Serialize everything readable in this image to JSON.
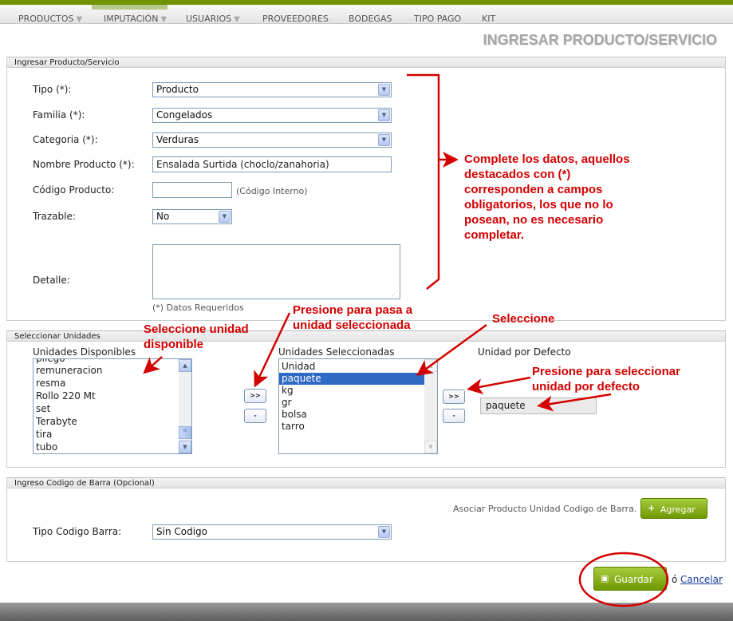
{
  "nav": {
    "items": [
      {
        "label": "PRODUCTOS",
        "arrow": "▼"
      },
      {
        "label": "IMPUTACIÓN",
        "arrow": "▼"
      },
      {
        "label": "USUARIOS",
        "arrow": "▼"
      },
      {
        "label": "PROVEEDORES"
      },
      {
        "label": "BODEGAS"
      },
      {
        "label": "TIPO PAGO"
      },
      {
        "label": "KIT"
      }
    ]
  },
  "page_title": "INGRESAR PRODUCTO/SERVICIO",
  "product_section": {
    "legend": "Ingresar Producto/Servicio",
    "tipo": {
      "label": "Tipo (*):",
      "value": "Producto"
    },
    "familia": {
      "label": "Familia (*):",
      "value": "Congelados"
    },
    "categoria": {
      "label": "Categoria (*):",
      "value": "Verduras"
    },
    "nombre": {
      "label": "Nombre Producto (*):",
      "value": "Ensalada Surtida (choclo/zanahoria)"
    },
    "codigo": {
      "label": "Código Producto:",
      "value": "",
      "hint": "(Código Interno)"
    },
    "trazable": {
      "label": "Trazable:",
      "value": "No"
    },
    "detalle": {
      "label": "Detalle:",
      "value": ""
    },
    "required_note": "(*) Datos Requeridos"
  },
  "units_section": {
    "legend": "Seleccionar Unidades",
    "available_label": "Unidades Disponibles",
    "available_items": [
      "pliego",
      "remuneracion",
      "resma",
      "Rollo 220 Mt",
      "set",
      "Terabyte",
      "tira",
      "tubo"
    ],
    "selected_label": "Unidades Seleccionadas",
    "selected_items": [
      "Unidad",
      "paquete",
      "kg",
      "gr",
      "bolsa",
      "tarro"
    ],
    "selected_highlight": "paquete",
    "default_label": "Unidad por Defecto",
    "default_value": "paquete",
    "add_button": ">>",
    "remove_button": "-",
    "set_default_button": ">>",
    "clear_default_button": "-"
  },
  "barcode_section": {
    "legend": "Ingreso Codigo de Barra (Opcional)",
    "associate_text": "Asociar Producto Unidad Codigo de Barra.",
    "add_button": "Agregar",
    "add_icon": "+",
    "tipo_label": "Tipo Codigo Barra:",
    "tipo_value": "Sin Codigo"
  },
  "actions": {
    "save_label": "Guardar",
    "save_icon": "▣",
    "separator": "ó",
    "cancel_label": "Cancelar"
  },
  "annotations": {
    "complete": "Complete los datos, aquellos destacados con (*) corresponden a campos obligatorios, los que no lo posean, no es necesario completar.",
    "presione_pasa": "Presione para pasa a unidad seleccionada",
    "seleccione_unidad": "Seleccione unidad disponible",
    "seleccione": "Seleccione",
    "presione_defecto": "Presione para seleccionar unidad por defecto"
  },
  "colors": {
    "accent": "#6f9400",
    "annotation": "#d40000",
    "selection": "#316ac5"
  },
  "icons": {
    "dropdown": "chevron-down-icon",
    "save": "floppy-icon",
    "add": "plus-icon"
  }
}
